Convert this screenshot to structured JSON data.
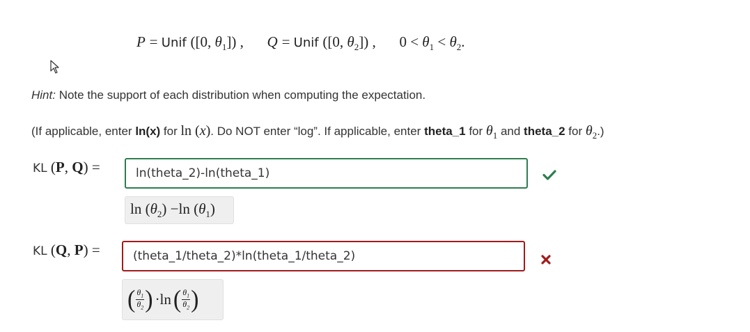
{
  "formula": {
    "p_label": "P",
    "q_label": "Q",
    "unif": "Unif",
    "theta1": "θ",
    "theta2": "θ",
    "sub1": "1",
    "sub2": "2",
    "zero_left": "0",
    "zero_interval": "0"
  },
  "hint": {
    "prefix": "Hint:",
    "text": "Note the support of each distribution when computing the expectation."
  },
  "instruction": {
    "part1": "(If applicable, enter ",
    "ln_entry": "ln(x)",
    "part2": " for ",
    "part3": ". Do NOT enter “log”. If applicable, enter ",
    "theta1_entry": "theta_1",
    "part4": " for ",
    "part5": " and ",
    "theta2_entry": "theta_2",
    "part6": " for ",
    "part7": ".)"
  },
  "kl_pq": {
    "word": "KL",
    "answer_value": "ln(theta_2)-ln(theta_1)",
    "status": "correct"
  },
  "kl_qp": {
    "word": "KL",
    "answer_value": "(theta_1/theta_2)*ln(theta_1/theta_2)",
    "status": "incorrect"
  },
  "colors": {
    "correct": "#2e7d4f",
    "incorrect": "#a11a1a",
    "preview_bg": "#efefef"
  },
  "icons": {
    "correct": "checkmark-icon",
    "incorrect": "x-mark-icon",
    "cursor": "mouse-pointer-icon"
  }
}
